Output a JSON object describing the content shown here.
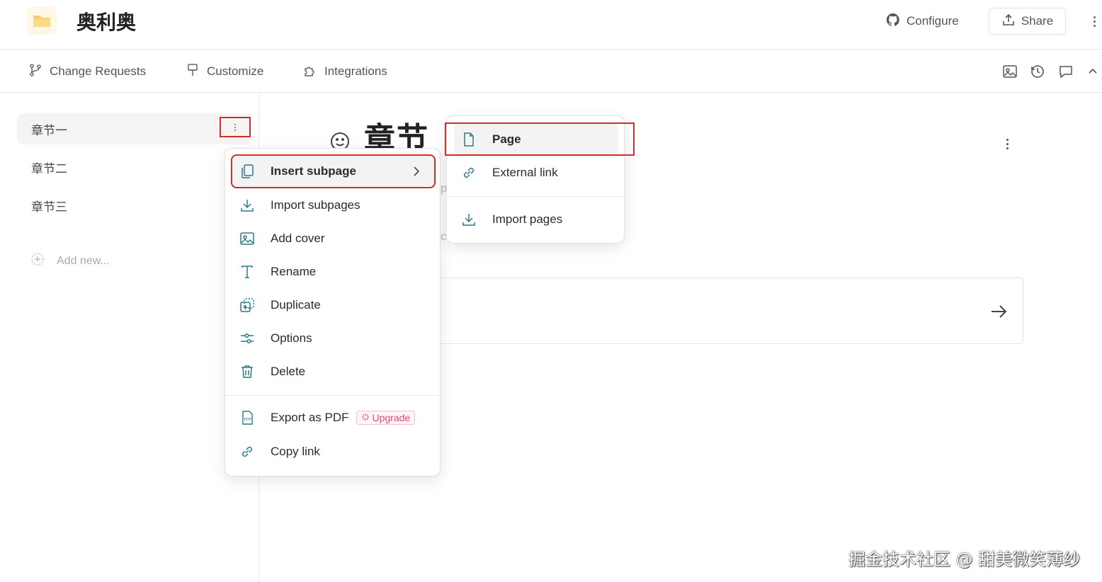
{
  "header": {
    "space_title": "奥利奥",
    "configure_label": "Configure",
    "share_label": "Share",
    "icons": [
      "folder-icon",
      "github-icon",
      "upload-icon",
      "more-vertical-icon"
    ]
  },
  "subbar": {
    "tabs": [
      {
        "label": "Change Requests",
        "icon": "branch-icon"
      },
      {
        "label": "Customize",
        "icon": "paint-brush-icon"
      },
      {
        "label": "Integrations",
        "icon": "puzzle-icon"
      }
    ],
    "tools": [
      "image-icon",
      "history-icon",
      "comment-icon",
      "chevron-up-icon"
    ]
  },
  "sidebar": {
    "items": [
      {
        "label": "章节一",
        "active": true
      },
      {
        "label": "章节二",
        "active": false
      },
      {
        "label": "章节三",
        "active": false
      }
    ],
    "add_new_label": "Add new..."
  },
  "main": {
    "title": "章节一",
    "peek_1": "p",
    "peek_2": "c"
  },
  "context_menu": {
    "items": [
      {
        "label": "Insert subpage",
        "icon": "copy-pages-icon",
        "has_submenu": true,
        "highlight": true
      },
      {
        "label": "Import subpages",
        "icon": "download-icon"
      },
      {
        "label": "Add cover",
        "icon": "image-icon"
      },
      {
        "label": "Rename",
        "icon": "text-icon"
      },
      {
        "label": "Duplicate",
        "icon": "duplicate-icon"
      },
      {
        "label": "Options",
        "icon": "sliders-icon"
      },
      {
        "label": "Delete",
        "icon": "trash-icon"
      }
    ],
    "export_label": "Export as PDF",
    "upgrade_label": "Upgrade",
    "copy_link_label": "Copy link"
  },
  "submenu": {
    "items": [
      {
        "label": "Page",
        "icon": "file-icon",
        "highlight": true
      },
      {
        "label": "External link",
        "icon": "link-icon"
      },
      {
        "label": "Import pages",
        "icon": "download-icon"
      }
    ]
  },
  "watermark": "掘金技术社区 @ 甜美微笑薄纱",
  "colors": {
    "accent": "#2b7a8a",
    "highlight_box": "#d42b2b",
    "upgrade": "#e0497c"
  }
}
